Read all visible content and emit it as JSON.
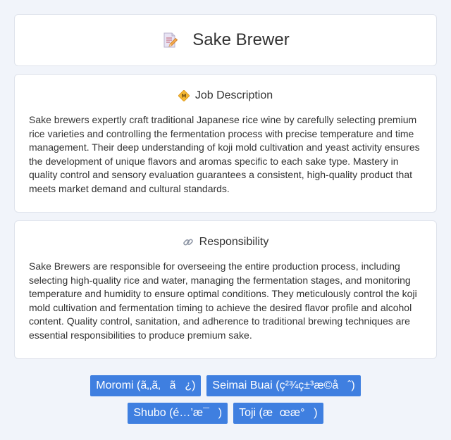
{
  "header": {
    "title": "Sake Brewer",
    "icon": "document-pencil-icon"
  },
  "job_description": {
    "title": "Job Description",
    "icon": "diamond-badge-icon",
    "text": "Sake brewers expertly craft traditional Japanese rice wine by carefully selecting premium rice varieties and controlling the fermentation process with precise temperature and time management. Their deep understanding of koji mold cultivation and yeast activity ensures the development of unique flavors and aromas specific to each sake type. Mastery in quality control and sensory evaluation guarantees a consistent, high-quality product that meets market demand and cultural standards."
  },
  "responsibility": {
    "title": "Responsibility",
    "icon": "link-icon",
    "text": "Sake Brewers are responsible for overseeing the entire production process, including selecting high-quality rice and water, managing the fermentation stages, and monitoring temperature and humidity to ensure optimal conditions. They meticulously control the koji mold cultivation and fermentation timing to achieve the desired flavor profile and alcohol content. Quality control, sanitation, and adherence to traditional brewing techniques are essential responsibilities to produce premium sake."
  },
  "tags": [
    "Moromi (ã‚‚ã‚ã¿)",
    "Seimai Buai (ç²¾ç±³æ­©åˆ)",
    "Shubo (é…’æ¯)",
    "Toji (æœæ°)"
  ],
  "colors": {
    "background": "#f1f4fa",
    "card": "#ffffff",
    "tag": "#3f7fe0"
  }
}
